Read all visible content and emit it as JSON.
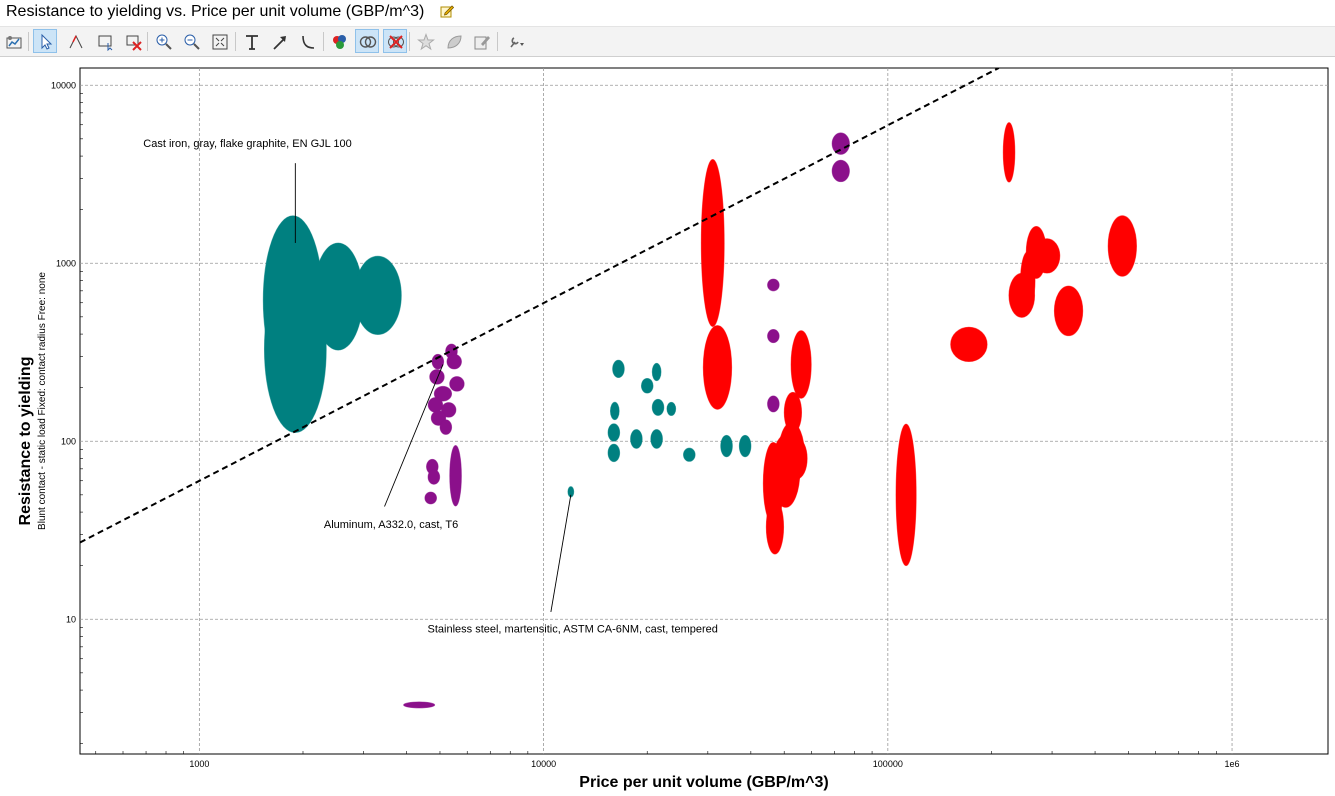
{
  "window": {
    "title": "Resistance to yielding vs. Price per unit volume (GBP/m^3)"
  },
  "toolbar": {
    "buttons": [
      {
        "name": "chart-properties-button",
        "icon": "chart-properties-icon",
        "active": false
      },
      {
        "name": "select-tool-button",
        "icon": "pointer-icon",
        "active": true
      },
      {
        "name": "line-selection-tool-button",
        "icon": "line-selection-icon",
        "active": false
      },
      {
        "name": "box-selection-tool-button",
        "icon": "box-selection-icon",
        "active": false
      },
      {
        "name": "delete-selection-button",
        "icon": "delete-selection-icon",
        "active": false
      },
      {
        "name": "zoom-in-button",
        "icon": "zoom-in-icon",
        "active": false
      },
      {
        "name": "zoom-out-button",
        "icon": "zoom-out-icon",
        "active": false
      },
      {
        "name": "zoom-fit-button",
        "icon": "zoom-fit-icon",
        "active": false
      },
      {
        "name": "text-tool-button",
        "icon": "text-icon",
        "active": false
      },
      {
        "name": "arrow-tool-button",
        "icon": "arrow-icon",
        "active": false
      },
      {
        "name": "curve-tool-button",
        "icon": "curve-icon",
        "active": false
      },
      {
        "name": "color-by-button",
        "icon": "color-palette-icon",
        "active": false
      },
      {
        "name": "show-intersection-button",
        "icon": "venn-intersection-icon",
        "active": true
      },
      {
        "name": "hide-failed-button",
        "icon": "hide-failed-icon",
        "active": true
      },
      {
        "name": "favorite-button",
        "icon": "star-icon",
        "active": false
      },
      {
        "name": "eco-button",
        "icon": "eco-icon",
        "active": false
      },
      {
        "name": "edit-notes-button",
        "icon": "notes-icon",
        "active": false
      },
      {
        "name": "more-tools-button",
        "icon": "tools-dropdown-icon",
        "active": false
      }
    ]
  },
  "colors": {
    "teal": "#008080",
    "purple": "#8B108B",
    "red": "#FF0000",
    "grid": "#999999",
    "guideline": "#000000"
  },
  "chart_data": {
    "type": "scatter",
    "title": "Resistance to yielding vs. Price per unit volume (GBP/m^3)",
    "xlabel": "Price per unit volume (GBP/m^3)",
    "ylabel": "Resistance to yielding",
    "ylabel_sub": "Blunt contact - static load   Fixed: contact radius   Free: none",
    "xscale": "log",
    "yscale": "log",
    "xlim": [
      450,
      1900000
    ],
    "ylim": [
      1.75,
      12500
    ],
    "grid": true,
    "xticks": [
      {
        "value": 1000,
        "label": "1000"
      },
      {
        "value": 10000,
        "label": "10000"
      },
      {
        "value": 100000,
        "label": "100000"
      },
      {
        "value": 1000000,
        "label": "1e6"
      }
    ],
    "yticks": [
      {
        "value": 10,
        "label": "10"
      },
      {
        "value": 100,
        "label": "100"
      },
      {
        "value": 1000,
        "label": "1000"
      },
      {
        "value": 10000,
        "label": "10000"
      }
    ],
    "guideline": {
      "x": [
        450,
        210000
      ],
      "y": [
        27,
        12500
      ],
      "style": "dashed"
    },
    "bubbles": [
      {
        "x": 1870,
        "y": 620,
        "xf": 1.22,
        "yf": 2.98,
        "color": "teal"
      },
      {
        "x": 1900,
        "y": 330,
        "xf": 1.23,
        "yf": 2.95,
        "color": "teal"
      },
      {
        "x": 2530,
        "y": 650,
        "xf": 1.18,
        "yf": 2.0,
        "color": "teal"
      },
      {
        "x": 3300,
        "y": 660,
        "xf": 1.17,
        "yf": 1.66,
        "color": "teal"
      },
      {
        "x": 4930,
        "y": 280,
        "xf": 1.04,
        "yf": 1.1,
        "color": "purple"
      },
      {
        "x": 5400,
        "y": 320,
        "xf": 1.04,
        "yf": 1.1,
        "color": "purple"
      },
      {
        "x": 5500,
        "y": 280,
        "xf": 1.05,
        "yf": 1.1,
        "color": "purple"
      },
      {
        "x": 4900,
        "y": 230,
        "xf": 1.05,
        "yf": 1.1,
        "color": "purple"
      },
      {
        "x": 5600,
        "y": 210,
        "xf": 1.05,
        "yf": 1.1,
        "color": "purple"
      },
      {
        "x": 5100,
        "y": 185,
        "xf": 1.06,
        "yf": 1.1,
        "color": "purple"
      },
      {
        "x": 4850,
        "y": 160,
        "xf": 1.05,
        "yf": 1.1,
        "color": "purple"
      },
      {
        "x": 5300,
        "y": 150,
        "xf": 1.05,
        "yf": 1.1,
        "color": "purple"
      },
      {
        "x": 4950,
        "y": 135,
        "xf": 1.05,
        "yf": 1.1,
        "color": "purple"
      },
      {
        "x": 5200,
        "y": 120,
        "xf": 1.04,
        "yf": 1.1,
        "color": "purple"
      },
      {
        "x": 4750,
        "y": 72,
        "xf": 1.04,
        "yf": 1.1,
        "color": "purple"
      },
      {
        "x": 4800,
        "y": 63,
        "xf": 1.04,
        "yf": 1.1,
        "color": "purple"
      },
      {
        "x": 4700,
        "y": 48,
        "xf": 1.04,
        "yf": 1.08,
        "color": "purple"
      },
      {
        "x": 5550,
        "y": 64,
        "xf": 1.04,
        "yf": 1.48,
        "color": "purple"
      },
      {
        "x": 4350,
        "y": 3.3,
        "xf": 1.11,
        "yf": 1.04,
        "color": "purple"
      },
      {
        "x": 12000,
        "y": 52,
        "xf": 1.02,
        "yf": 1.07,
        "color": "teal"
      },
      {
        "x": 16500,
        "y": 255,
        "xf": 1.04,
        "yf": 1.12,
        "color": "teal"
      },
      {
        "x": 20000,
        "y": 205,
        "xf": 1.04,
        "yf": 1.1,
        "color": "teal"
      },
      {
        "x": 21300,
        "y": 245,
        "xf": 1.03,
        "yf": 1.12,
        "color": "teal"
      },
      {
        "x": 16100,
        "y": 148,
        "xf": 1.03,
        "yf": 1.12,
        "color": "teal"
      },
      {
        "x": 16000,
        "y": 112,
        "xf": 1.04,
        "yf": 1.12,
        "color": "teal"
      },
      {
        "x": 16000,
        "y": 86,
        "xf": 1.04,
        "yf": 1.12,
        "color": "teal"
      },
      {
        "x": 18600,
        "y": 103,
        "xf": 1.04,
        "yf": 1.13,
        "color": "teal"
      },
      {
        "x": 21300,
        "y": 103,
        "xf": 1.04,
        "yf": 1.13,
        "color": "teal"
      },
      {
        "x": 21500,
        "y": 155,
        "xf": 1.04,
        "yf": 1.11,
        "color": "teal"
      },
      {
        "x": 23500,
        "y": 152,
        "xf": 1.03,
        "yf": 1.09,
        "color": "teal"
      },
      {
        "x": 26500,
        "y": 84,
        "xf": 1.04,
        "yf": 1.09,
        "color": "teal"
      },
      {
        "x": 34000,
        "y": 94,
        "xf": 1.04,
        "yf": 1.15,
        "color": "teal"
      },
      {
        "x": 38500,
        "y": 94,
        "xf": 1.04,
        "yf": 1.15,
        "color": "teal"
      },
      {
        "x": 31000,
        "y": 1300,
        "xf": 1.08,
        "yf": 2.95,
        "color": "red"
      },
      {
        "x": 32000,
        "y": 260,
        "xf": 1.1,
        "yf": 1.72,
        "color": "red"
      },
      {
        "x": 46500,
        "y": 58,
        "xf": 1.07,
        "yf": 1.7,
        "color": "red"
      },
      {
        "x": 50500,
        "y": 68,
        "xf": 1.1,
        "yf": 1.6,
        "color": "red"
      },
      {
        "x": 52500,
        "y": 85,
        "xf": 1.09,
        "yf": 1.5,
        "color": "red"
      },
      {
        "x": 47000,
        "y": 33,
        "xf": 1.06,
        "yf": 1.42,
        "color": "red"
      },
      {
        "x": 54500,
        "y": 80,
        "xf": 1.07,
        "yf": 1.3,
        "color": "red"
      },
      {
        "x": 53000,
        "y": 145,
        "xf": 1.06,
        "yf": 1.3,
        "color": "red"
      },
      {
        "x": 56000,
        "y": 270,
        "xf": 1.07,
        "yf": 1.55,
        "color": "red"
      },
      {
        "x": 46500,
        "y": 755,
        "xf": 1.04,
        "yf": 1.08,
        "color": "purple"
      },
      {
        "x": 46500,
        "y": 390,
        "xf": 1.04,
        "yf": 1.09,
        "color": "purple"
      },
      {
        "x": 46500,
        "y": 162,
        "xf": 1.04,
        "yf": 1.11,
        "color": "purple"
      },
      {
        "x": 73000,
        "y": 4700,
        "xf": 1.06,
        "yf": 1.15,
        "color": "purple"
      },
      {
        "x": 73000,
        "y": 3300,
        "xf": 1.06,
        "yf": 1.15,
        "color": "purple"
      },
      {
        "x": 113000,
        "y": 50,
        "xf": 1.07,
        "yf": 2.5,
        "color": "red"
      },
      {
        "x": 172000,
        "y": 350,
        "xf": 1.13,
        "yf": 1.25,
        "color": "red"
      },
      {
        "x": 225000,
        "y": 4200,
        "xf": 1.04,
        "yf": 1.47,
        "color": "red"
      },
      {
        "x": 245000,
        "y": 660,
        "xf": 1.09,
        "yf": 1.33,
        "color": "red"
      },
      {
        "x": 255000,
        "y": 800,
        "xf": 1.05,
        "yf": 1.45,
        "color": "red"
      },
      {
        "x": 270000,
        "y": 1150,
        "xf": 1.07,
        "yf": 1.4,
        "color": "red"
      },
      {
        "x": 290000,
        "y": 1100,
        "xf": 1.09,
        "yf": 1.25,
        "color": "red"
      },
      {
        "x": 335000,
        "y": 540,
        "xf": 1.1,
        "yf": 1.38,
        "color": "red"
      },
      {
        "x": 480000,
        "y": 1250,
        "xf": 1.1,
        "yf": 1.48,
        "color": "red"
      }
    ],
    "annotations": [
      {
        "label": "Cast iron, gray, flake graphite, EN GJL 100",
        "tx": 1380,
        "ty": 4500,
        "anchor": "middle",
        "lx1": 1900,
        "ly1": 3650,
        "lx2": 1900,
        "ly2": 1300
      },
      {
        "label": "Aluminum, A332.0, cast, T6",
        "tx": 2300,
        "ty": 32.5,
        "anchor": "start",
        "lx1": 3450,
        "ly1": 43,
        "lx2": 5100,
        "ly2": 270
      },
      {
        "label": "Stainless steel, martensitic, ASTM CA-6NM, cast, tempered",
        "tx": 4600,
        "ty": 8.4,
        "anchor": "start",
        "lx1": 10500,
        "ly1": 11,
        "lx2": 12000,
        "ly2": 50
      }
    ]
  }
}
